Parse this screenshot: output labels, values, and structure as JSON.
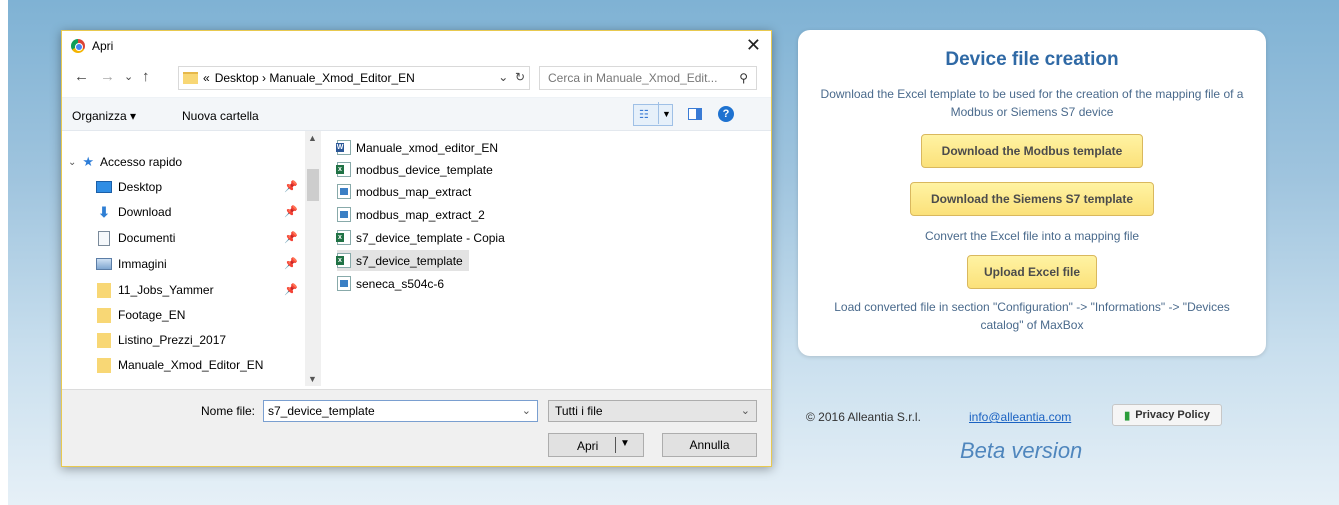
{
  "dialog": {
    "title": "Apri",
    "close_glyph": "✕",
    "nav": {
      "back": "←",
      "forward": "→",
      "recent": "⌄",
      "up": "↑"
    },
    "address": {
      "prefix": "«",
      "path": "Desktop  ›  Manuale_Xmod_Editor_EN",
      "dropdown": "⌄",
      "refresh": "↻"
    },
    "search_placeholder": "Cerca in Manuale_Xmod_Edit...",
    "toolbar": {
      "organize": "Organizza ▾",
      "new_folder": "Nuova cartella",
      "help": "?"
    },
    "nav_pane": {
      "section": "Accesso rapido",
      "items": [
        {
          "label": "Desktop",
          "icon": "desktop-icon",
          "pinned": true
        },
        {
          "label": "Download",
          "icon": "download-icon",
          "pinned": true
        },
        {
          "label": "Documenti",
          "icon": "documents-icon",
          "pinned": true
        },
        {
          "label": "Immagini",
          "icon": "pictures-icon",
          "pinned": true
        },
        {
          "label": "11_Jobs_Yammer",
          "icon": "folder-icon",
          "pinned": true
        },
        {
          "label": "Footage_EN",
          "icon": "folder-icon",
          "pinned": false
        },
        {
          "label": "Listino_Prezzi_2017",
          "icon": "folder-icon",
          "pinned": false
        },
        {
          "label": "Manuale_Xmod_Editor_EN",
          "icon": "folder-icon",
          "pinned": false
        }
      ]
    },
    "files": [
      {
        "name": "Manuale_xmod_editor_EN",
        "type": "word"
      },
      {
        "name": "modbus_device_template",
        "type": "excel"
      },
      {
        "name": "modbus_map_extract",
        "type": "img"
      },
      {
        "name": "modbus_map_extract_2",
        "type": "img"
      },
      {
        "name": "s7_device_template - Copia",
        "type": "excel"
      },
      {
        "name": "s7_device_template",
        "type": "excel",
        "selected": true
      },
      {
        "name": "seneca_s504c-6",
        "type": "img"
      }
    ],
    "filename_label": "Nome file:",
    "filename_value": "s7_device_template",
    "filetype": "Tutti i file",
    "open_label": "Apri",
    "cancel_label": "Annulla"
  },
  "panel": {
    "title": "Device file creation",
    "desc1": "Download the Excel template to be used for the creation of the mapping file of a Modbus or Siemens S7 device",
    "btn_modbus": "Download the Modbus template",
    "btn_s7": "Download the Siemens S7 template",
    "desc2": "Convert the Excel file into a mapping file",
    "btn_upload": "Upload Excel file",
    "desc3": "Load converted file in section \"Configuration\" -> \"Informations\" -> \"Devices catalog\" of MaxBox"
  },
  "footer": {
    "copyright": "© 2016 Alleantia S.r.l.",
    "email": "info@alleantia.com",
    "privacy": "Privacy Policy",
    "beta": "Beta version"
  }
}
